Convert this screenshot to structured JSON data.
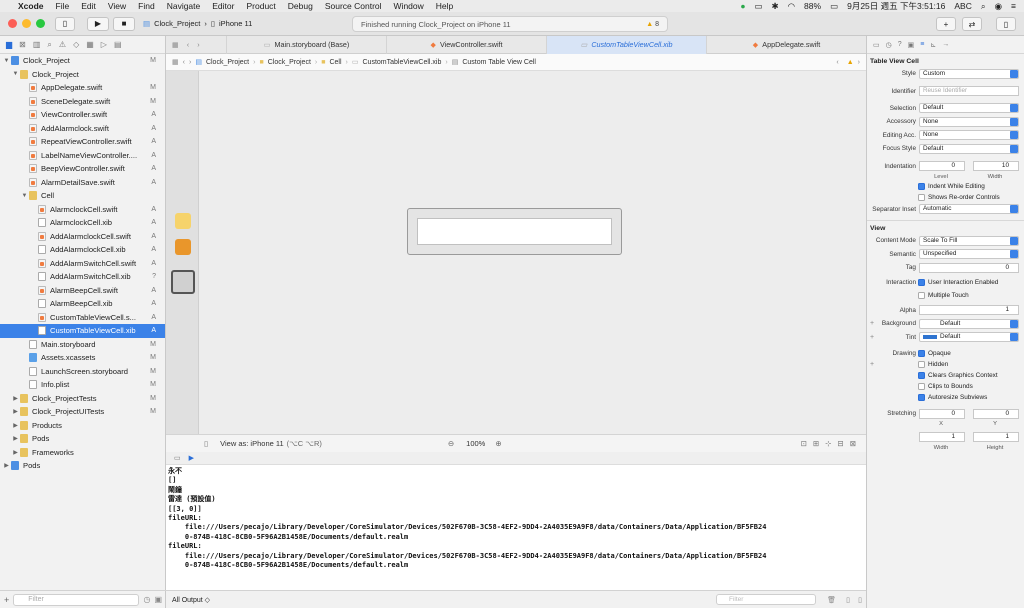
{
  "menubar": {
    "app": "Xcode",
    "items": [
      "File",
      "Edit",
      "View",
      "Find",
      "Navigate",
      "Editor",
      "Product",
      "Debug",
      "Source Control",
      "Window",
      "Help"
    ],
    "battery": "88%",
    "clock": "9月25日 週五 下午3:51:16",
    "input": "ABC"
  },
  "toolbar": {
    "scheme": "Clock_Project",
    "device": "iPhone 11",
    "status_text": "Finished running Clock_Project on iPhone 11",
    "warning_count": "8"
  },
  "navigator": {
    "filter_placeholder": "Filter",
    "items": [
      {
        "label": "Clock_Project",
        "status": "M"
      },
      {
        "label": "Clock_Project",
        "status": ""
      },
      {
        "label": "AppDelegate.swift",
        "status": "M"
      },
      {
        "label": "SceneDelegate.swift",
        "status": "M"
      },
      {
        "label": "ViewController.swift",
        "status": "A"
      },
      {
        "label": "AddAlarmclock.swift",
        "status": "A"
      },
      {
        "label": "RepeatViewController.swift",
        "status": "A"
      },
      {
        "label": "LabelNameViewController....",
        "status": "A"
      },
      {
        "label": "BeepViewController.swift",
        "status": "A"
      },
      {
        "label": "AlarmDetailSave.swift",
        "status": "A"
      },
      {
        "label": "Cell",
        "status": ""
      },
      {
        "label": "AlarmclockCell.swift",
        "status": "A"
      },
      {
        "label": "AlarmclockCell.xib",
        "status": "A"
      },
      {
        "label": "AddAlarmclockCell.swift",
        "status": "A"
      },
      {
        "label": "AddAlarmclockCell.xib",
        "status": "A"
      },
      {
        "label": "AddAlarmSwitchCell.swift",
        "status": "A"
      },
      {
        "label": "AddAlarmSwitchCell.xib",
        "status": "?"
      },
      {
        "label": "AlarmBeepCell.swift",
        "status": "A"
      },
      {
        "label": "AlarmBeepCell.xib",
        "status": "A"
      },
      {
        "label": "CustomTableViewCell.s...",
        "status": "A"
      },
      {
        "label": "CustomTableViewCell.xib",
        "status": "A"
      },
      {
        "label": "Main.storyboard",
        "status": "M"
      },
      {
        "label": "Assets.xcassets",
        "status": "M"
      },
      {
        "label": "LaunchScreen.storyboard",
        "status": "M"
      },
      {
        "label": "Info.plist",
        "status": "M"
      },
      {
        "label": "Clock_ProjectTests",
        "status": "M"
      },
      {
        "label": "Clock_ProjectUITests",
        "status": "M"
      },
      {
        "label": "Products",
        "status": ""
      },
      {
        "label": "Pods",
        "status": ""
      },
      {
        "label": "Frameworks",
        "status": ""
      },
      {
        "label": "Pods",
        "status": ""
      }
    ]
  },
  "tabs": [
    {
      "label": "Main.storyboard (Base)"
    },
    {
      "label": "ViewController.swift"
    },
    {
      "label": "CustomTableViewCell.xib"
    },
    {
      "label": "AppDelegate.swift"
    }
  ],
  "jumpbar": [
    "Clock_Project",
    "Clock_Project",
    "Cell",
    "CustomTableViewCell.xib",
    "Custom Table View Cell"
  ],
  "canvas": {
    "view_as": "View as: iPhone 11",
    "view_as_hint": "(⌥C ⌥R)",
    "zoom": "100%"
  },
  "console": {
    "lines": [
      "永不",
      "[]",
      "鬧鐘",
      "雷達 (預設值)",
      "[[3, 0]]",
      "fileURL:",
      "    file:///Users/pecajo/Library/Developer/CoreSimulator/Devices/502F670B-3C58-4EF2-9DD4-2A4035E9A9F8/data/Containers/Data/Application/BF5FB24",
      "    0-874B-418C-8CB0-5F96A2B1458E/Documents/default.realm",
      "fileURL:",
      "    file:///Users/pecajo/Library/Developer/CoreSimulator/Devices/502F670B-3C58-4EF2-9DD4-2A4035E9A9F8/data/Containers/Data/Application/BF5FB24",
      "    0-874B-418C-8CB0-5F96A2B1458E/Documents/default.realm"
    ],
    "output_selector": "All Output ◇",
    "filter_placeholder": "Filter"
  },
  "inspector": {
    "section1": "Table View Cell",
    "style_label": "Style",
    "style_value": "Custom",
    "identifier_label": "Identifier",
    "identifier_placeholder": "Reuse Identifier",
    "selection_label": "Selection",
    "selection_value": "Default",
    "accessory_label": "Accessory",
    "accessory_value": "None",
    "editing_label": "Editing Acc.",
    "editing_value": "None",
    "focus_label": "Focus Style",
    "focus_value": "Default",
    "indentation_label": "Indentation",
    "level_value": "0",
    "width_value": "10",
    "level_sub": "Level",
    "width_sub": "Width",
    "indent_editing": "Indent While Editing",
    "shows_reorder": "Shows Re-order Controls",
    "separator_label": "Separator Inset",
    "separator_value": "Automatic",
    "section2": "View",
    "content_mode_label": "Content Mode",
    "content_mode_value": "Scale To Fill",
    "semantic_label": "Semantic",
    "semantic_value": "Unspecified",
    "tag_label": "Tag",
    "tag_value": "0",
    "interaction_label": "Interaction",
    "user_interaction": "User Interaction Enabled",
    "multiple_touch": "Multiple Touch",
    "alpha_label": "Alpha",
    "alpha_value": "1",
    "background_label": "Background",
    "background_value": "Default",
    "tint_label": "Tint",
    "tint_value": "Default",
    "drawing_label": "Drawing",
    "opaque": "Opaque",
    "hidden": "Hidden",
    "clears_graphics": "Clears Graphics Context",
    "clips_bounds": "Clips to Bounds",
    "autoresize": "Autoresize Subviews",
    "stretching_label": "Stretching",
    "stretch_x": "0",
    "stretch_y": "0",
    "stretch_w": "1",
    "stretch_h": "1",
    "x_sub": "X",
    "y_sub": "Y",
    "w_sub": "Width",
    "h_sub": "Height",
    "tint_color": "#2f74d0"
  }
}
